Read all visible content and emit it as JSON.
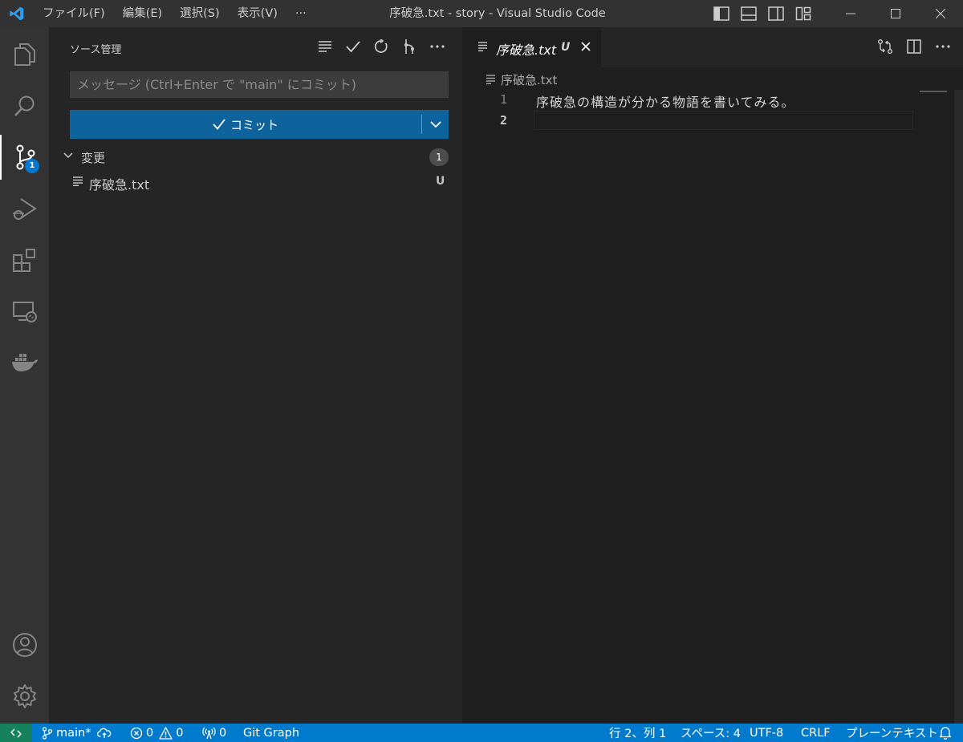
{
  "titlebar": {
    "menus": [
      "ファイル(F)",
      "編集(E)",
      "選択(S)",
      "表示(V)",
      "···"
    ],
    "window_title": "序破急.txt - story - Visual Studio Code"
  },
  "activitybar": {
    "items": [
      "explorer",
      "search",
      "source-control",
      "run-and-debug",
      "extensions",
      "remote-explorer",
      "docker"
    ],
    "source_control_badge": "1",
    "bottom_items": [
      "accounts",
      "manage"
    ]
  },
  "sidebar": {
    "title": "ソース管理",
    "commit_placeholder": "メッセージ (Ctrl+Enter で \"main\" にコミット)",
    "commit_label": "コミット",
    "changes_label": "変更",
    "changes_count": "1",
    "files": [
      {
        "name": "序破急.txt",
        "status": "U"
      }
    ]
  },
  "editor": {
    "tab": {
      "name": "序破急.txt",
      "status": "U"
    },
    "breadcrumb": "序破急.txt",
    "lines": [
      {
        "number": "1",
        "text": "序破急の構造が分かる物語を書いてみる。"
      },
      {
        "number": "2",
        "text": ""
      }
    ]
  },
  "statusbar": {
    "branch": "main*",
    "errors": "0",
    "warnings": "0",
    "ports": "0",
    "git_graph": "Git Graph",
    "cursor_pos": "行 2、列 1",
    "indent": "スペース: 4",
    "encoding": "UTF-8",
    "eol": "CRLF",
    "language": "プレーンテキスト"
  },
  "colors": {
    "accent": "#0e639c",
    "statusbar": "#007acc",
    "remote": "#16825d",
    "badge": "#0078d4"
  }
}
